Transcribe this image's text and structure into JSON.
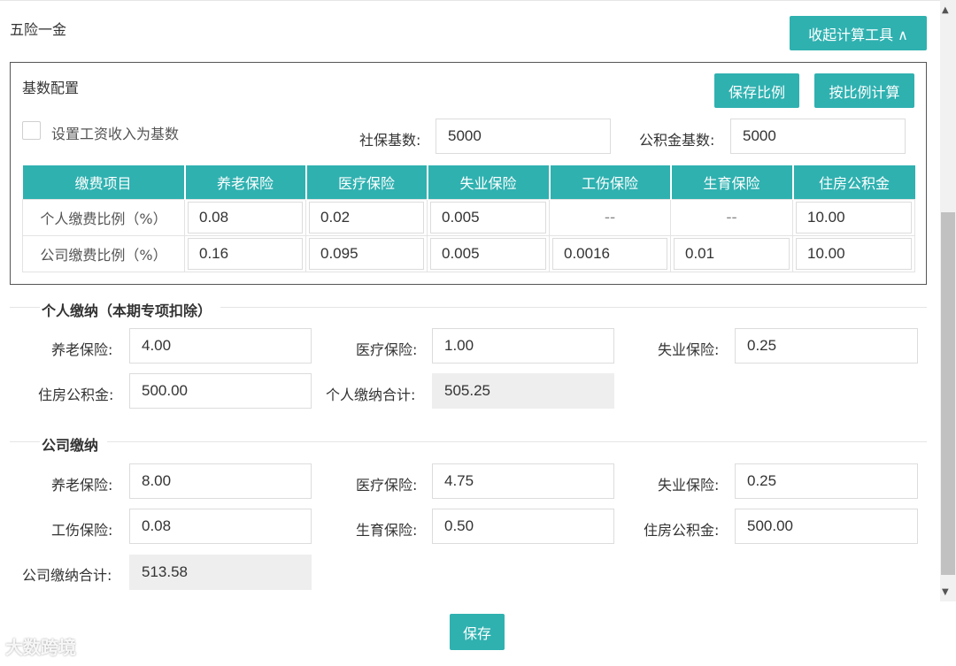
{
  "page_title": "五险一金",
  "collapse_button": "收起计算工具 ∧",
  "config": {
    "title": "基数配置",
    "save_ratio_button": "保存比例",
    "calc_by_ratio_button": "按比例计算",
    "salary_as_base_label": "设置工资收入为基数",
    "salary_as_base_checked": false,
    "social_base_label": "社保基数:",
    "social_base_value": "5000",
    "fund_base_label": "公积金基数:",
    "fund_base_value": "5000"
  },
  "rate_table": {
    "headers": [
      "缴费项目",
      "养老保险",
      "医疗保险",
      "失业保险",
      "工伤保险",
      "生育保险",
      "住房公积金"
    ],
    "rows": [
      {
        "label": "个人缴费比例（%）",
        "cells": [
          "0.08",
          "0.02",
          "0.005",
          "--",
          "--",
          "10.00"
        ]
      },
      {
        "label": "公司缴费比例（%）",
        "cells": [
          "0.16",
          "0.095",
          "0.005",
          "0.0016",
          "0.01",
          "10.00"
        ]
      }
    ]
  },
  "personal": {
    "title": "个人缴纳（本期专项扣除）",
    "pension_label": "养老保险:",
    "pension_value": "4.00",
    "medical_label": "医疗保险:",
    "medical_value": "1.00",
    "unemployment_label": "失业保险:",
    "unemployment_value": "0.25",
    "housing_label": "住房公积金:",
    "housing_value": "500.00",
    "total_label": "个人缴纳合计:",
    "total_value": "505.25"
  },
  "company": {
    "title": "公司缴纳",
    "pension_label": "养老保险:",
    "pension_value": "8.00",
    "medical_label": "医疗保险:",
    "medical_value": "4.75",
    "unemployment_label": "失业保险:",
    "unemployment_value": "0.25",
    "injury_label": "工伤保险:",
    "injury_value": "0.08",
    "maternity_label": "生育保险:",
    "maternity_value": "0.50",
    "housing_label": "住房公积金:",
    "housing_value": "500.00",
    "total_label": "公司缴纳合计:",
    "total_value": "513.58"
  },
  "save_button": "保存",
  "watermark": "大数跨境",
  "colors": {
    "accent": "#2fb1b0",
    "readonly_bg": "#eeeeee"
  }
}
